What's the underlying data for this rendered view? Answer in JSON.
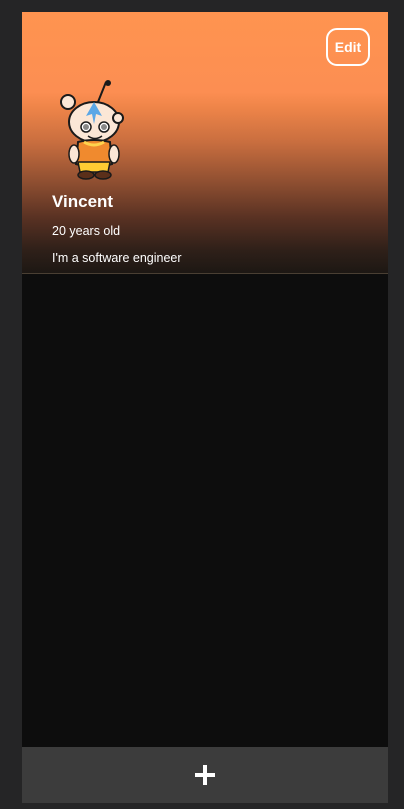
{
  "profile": {
    "name": "Vincent",
    "age_text": "20 years old",
    "bio": "I'm a software engineer",
    "avatar_icon": "cartoon-monk-avatar"
  },
  "header": {
    "edit_label": "Edit"
  },
  "footer": {
    "add_icon": "plus-icon"
  },
  "colors": {
    "header_top": "#ff9450",
    "header_bottom": "#1c1713",
    "content_bg": "#0d0d0d",
    "footer_bg": "#3c3c3c",
    "outer_bg": "#252526",
    "text": "#ffffff"
  }
}
